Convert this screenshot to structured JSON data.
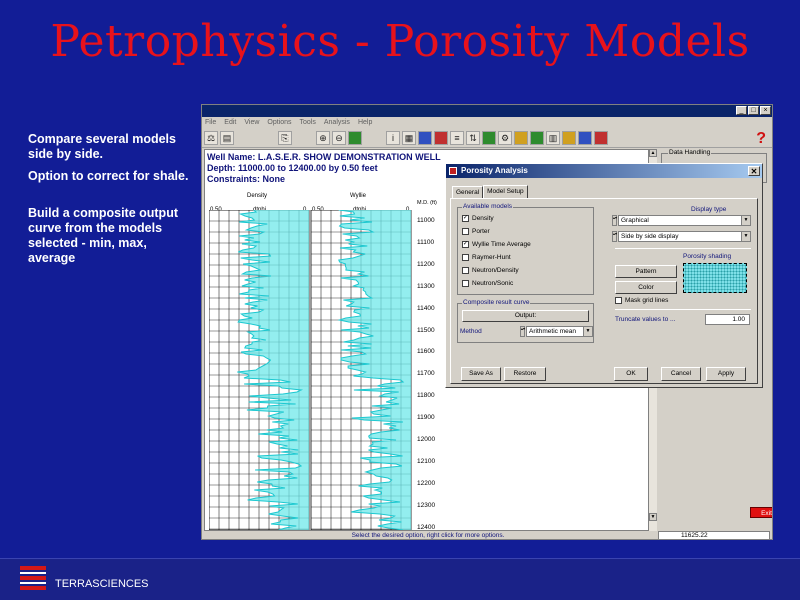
{
  "slide": {
    "title": "Petrophysics - Porosity Models",
    "bullets": [
      "Compare several models side by side.",
      "Option to correct for shale.",
      "Build a composite output curve from the models selected - min, max, average"
    ],
    "brand": "TERRASCIENCES"
  },
  "app": {
    "menu": [
      "File",
      "Edit",
      "View",
      "Options",
      "Tools",
      "Analysis",
      "Help"
    ],
    "well_name": "Well Name:    L.A.S.E.R. SHOW DEMONSTRATION WELL",
    "depth": "Depth:  11000.00 to 12400.00 by  0.50 feet",
    "constraints": "Constraints:  None",
    "tracks": [
      {
        "title": "Density",
        "unit": "dtphi",
        "scale_left": "0.50",
        "scale_right": "0"
      },
      {
        "title": "Wyllie",
        "unit": "dtphi",
        "scale_left": "0.50",
        "scale_right": "0"
      }
    ],
    "depth_header": "M.D. (ft)",
    "depth_labels": [
      "11000",
      "11100",
      "11200",
      "11300",
      "11400",
      "11500",
      "11600",
      "11700",
      "11800",
      "11900",
      "12000",
      "12100",
      "12200",
      "12300",
      "12400"
    ],
    "status_text": "Select the desired option, right click for more options.",
    "status_value": "11625.22",
    "side_group": "Data Handling",
    "exit_button": "Exit Petrophysics"
  },
  "dialog": {
    "title": "Porosity Analysis",
    "tabs": [
      "General",
      "Model Setup"
    ],
    "available_models_title": "Available models",
    "models": [
      {
        "label": "Density",
        "checked": true
      },
      {
        "label": "Porter",
        "checked": false
      },
      {
        "label": "Wyllie Time Average",
        "checked": true
      },
      {
        "label": "Raymer-Hunt",
        "checked": false
      },
      {
        "label": "Neutron/Density",
        "checked": false
      },
      {
        "label": "Neutron/Sonic",
        "checked": false
      }
    ],
    "composite_title": "Composite result curve",
    "output_button": "Output:",
    "method_label": "Method",
    "method_value": "Arithmetic mean",
    "display_type_title": "Display type",
    "display_type_1": "Graphical",
    "display_type_2": "Side by side display",
    "porosity_shading_title": "Porosity shading",
    "pattern_button": "Pattern",
    "color_button": "Color",
    "mask_grid_label": "Mask grid lines",
    "truncate_label": "Truncate values to ...",
    "truncate_value": "1.00",
    "save_as_button": "Save As",
    "restore_button": "Restore",
    "ok_button": "OK",
    "cancel_button": "Cancel",
    "apply_button": "Apply"
  }
}
